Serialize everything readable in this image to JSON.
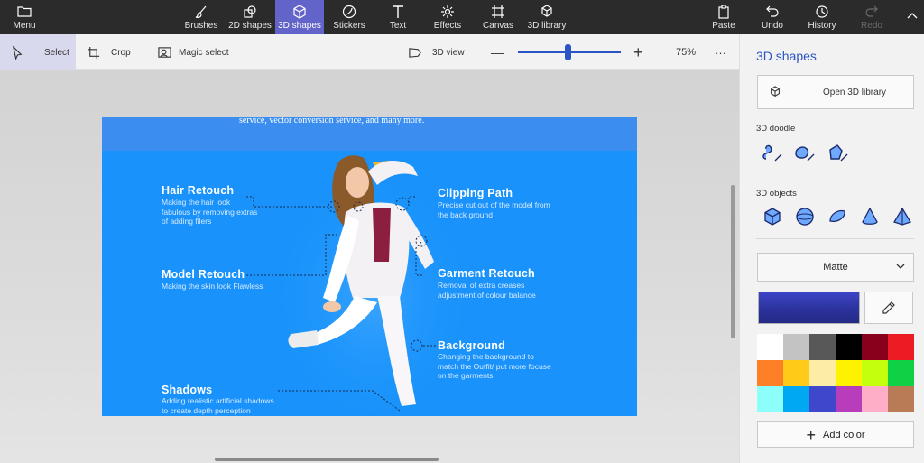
{
  "topbar": {
    "menu": "Menu",
    "tools": [
      {
        "label": "Brushes",
        "icon": "brush-icon"
      },
      {
        "label": "2D shapes",
        "icon": "shapes-2d-icon"
      },
      {
        "label": "3D shapes",
        "icon": "cube-icon"
      },
      {
        "label": "Stickers",
        "icon": "sticker-icon"
      },
      {
        "label": "Text",
        "icon": "text-icon"
      },
      {
        "label": "Effects",
        "icon": "effects-icon"
      },
      {
        "label": "Canvas",
        "icon": "canvas-icon"
      },
      {
        "label": "3D library",
        "icon": "library-icon"
      }
    ],
    "paste": "Paste",
    "undo": "Undo",
    "history": "History",
    "redo": "Redo",
    "active_color": "#6264c9"
  },
  "subbar": {
    "select": "Select",
    "crop": "Crop",
    "magic_select": "Magic select",
    "view_3d": "3D view",
    "zoom_minus": "—",
    "zoom_plus": "+",
    "zoom_level": "75%",
    "more": "···",
    "zoom_slider_value": 0.48
  },
  "canvas_content": {
    "top_text": "service, vector conversion service, and many more.",
    "features": [
      {
        "title": "Hair Retouch",
        "desc": [
          "Making the hair look",
          "fabulous by removing extras",
          "of adding filers"
        ]
      },
      {
        "title": "Model Retouch",
        "desc": [
          "Making the skin look Flawless"
        ]
      },
      {
        "title": "Shadows",
        "desc": [
          "Adding realistic artificial shadows",
          "to create depth perception"
        ]
      },
      {
        "title": "Clipping Path",
        "desc": [
          "Precise cut out of the model from",
          "the back ground"
        ]
      },
      {
        "title": "Garment Retouch",
        "desc": [
          "Removal of extra creases",
          "adjustment of colour balance"
        ]
      },
      {
        "title": "Background",
        "desc": [
          "Changing the background to",
          "match the Outfit/ put more focuse",
          "on the garments"
        ]
      }
    ]
  },
  "panel": {
    "title": "3D shapes",
    "open_library": "Open 3D library",
    "doodle_label": "3D doodle",
    "doodles": [
      "sharp-edge-doodle-icon",
      "soft-edge-doodle-icon",
      "tube-doodle-icon"
    ],
    "objects_label": "3D objects",
    "objects": [
      "cube-icon",
      "sphere-icon",
      "hemisphere-icon",
      "cone-icon",
      "pyramid-icon"
    ],
    "material": "Matte",
    "add_color": "Add color",
    "accent_color": "#2b55c4",
    "palette": [
      "#ffffff",
      "#c3c3c3",
      "#585858",
      "#000000",
      "#88001b",
      "#ec1c24",
      "#ff7f27",
      "#ffca18",
      "#fdeca6",
      "#fff200",
      "#c4ff0e",
      "#0ed145",
      "#8cfffb",
      "#00a8f3",
      "#3f48cc",
      "#b83dba",
      "#ffaec8",
      "#b97a56"
    ]
  }
}
